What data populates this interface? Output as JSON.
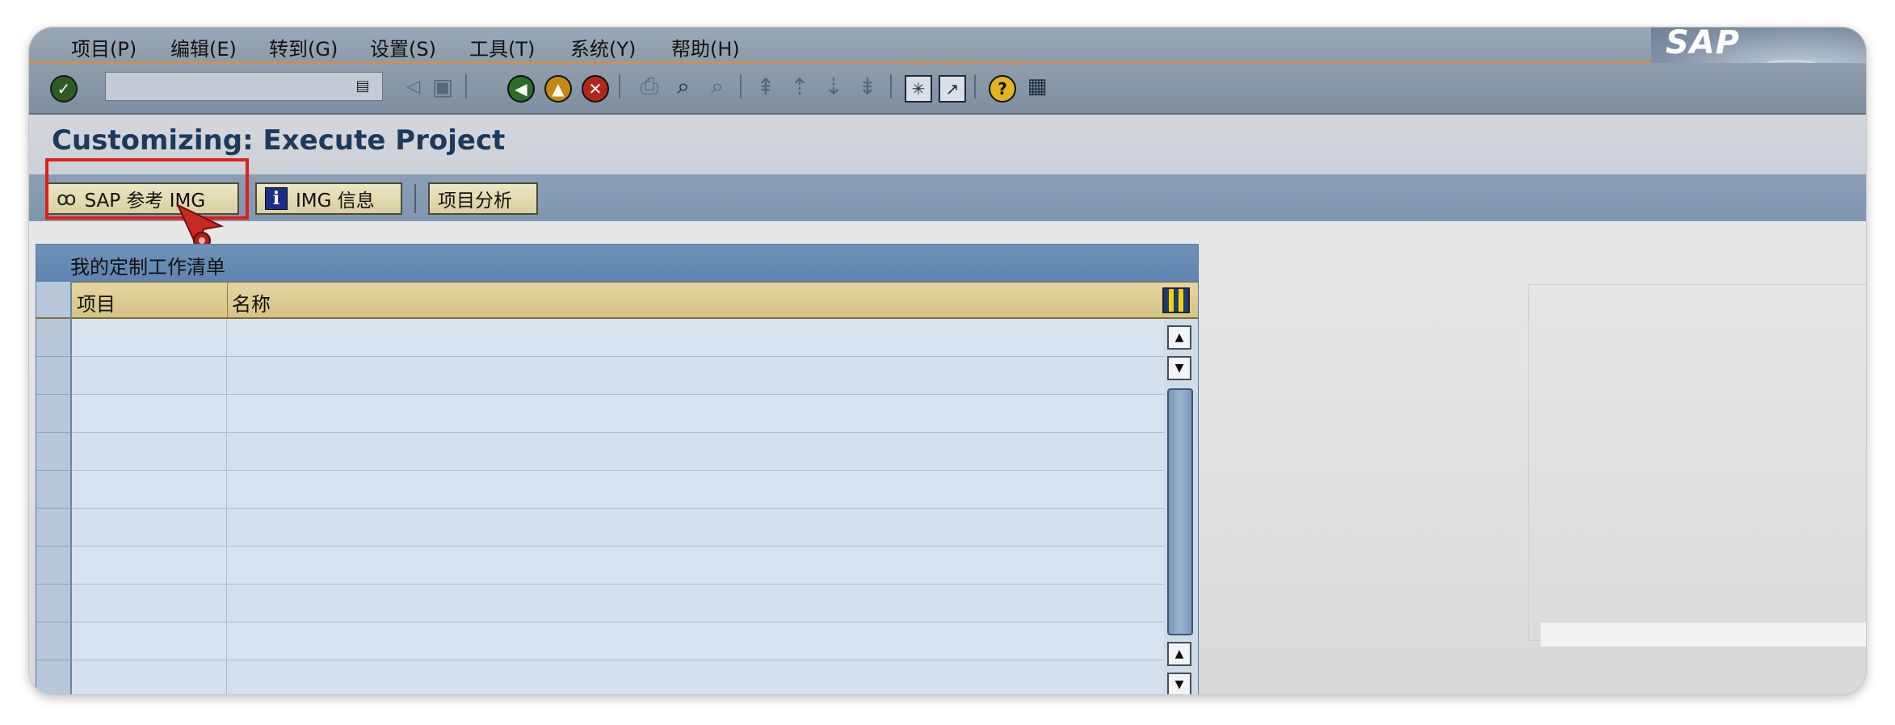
{
  "menu": {
    "items": [
      "项目(P)",
      "编辑(E)",
      "转到(G)",
      "设置(S)",
      "工具(T)",
      "系统(Y)",
      "帮助(H)"
    ]
  },
  "logo": {
    "text": "SAP"
  },
  "title": "Customizing: Execute Project",
  "toolbar": {
    "command_field_value": "",
    "icons": [
      "check-icon",
      "dropdown-icon",
      "back-arrow-icon",
      "save-icon",
      "back-icon",
      "exit-icon",
      "cancel-icon",
      "print-icon",
      "find-icon",
      "find-next-icon",
      "first-page-icon",
      "previous-page-icon",
      "next-page-icon",
      "last-page-icon",
      "create-session-icon",
      "shortcut-icon",
      "help-icon",
      "customize-layout-icon"
    ]
  },
  "app_toolbar": {
    "sap_img_label": "SAP 参考 IMG",
    "img_info_label": "IMG 信息",
    "project_analysis_label": "项目分析"
  },
  "worklist": {
    "title": "我的定制工作清单",
    "columns": [
      "项目",
      "名称"
    ],
    "rows": [
      {
        "project": "",
        "name": ""
      },
      {
        "project": "",
        "name": ""
      },
      {
        "project": "",
        "name": ""
      },
      {
        "project": "",
        "name": ""
      },
      {
        "project": "",
        "name": ""
      },
      {
        "project": "",
        "name": ""
      },
      {
        "project": "",
        "name": ""
      },
      {
        "project": "",
        "name": ""
      },
      {
        "project": "",
        "name": ""
      },
      {
        "project": "",
        "name": ""
      }
    ]
  },
  "colors": {
    "accent_highlight": "#e0201b",
    "menu_underline": "#e88b27",
    "title_text": "#1d3a5a",
    "column_header": "#d6c483"
  }
}
